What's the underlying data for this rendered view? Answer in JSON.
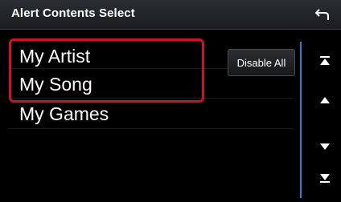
{
  "header": {
    "title": "Alert Contents Select",
    "back_icon": "back-arrow-icon"
  },
  "list": {
    "items": [
      "My Artist",
      "My Song",
      "My Games"
    ]
  },
  "disable_all_label": "Disable All",
  "scroll": {
    "icons": [
      "scroll-top-icon",
      "scroll-up-icon",
      "scroll-down-icon",
      "scroll-bottom-icon"
    ]
  },
  "colors": {
    "accent": "#168ad6",
    "highlight": "#d0102a",
    "background": "#000000"
  }
}
